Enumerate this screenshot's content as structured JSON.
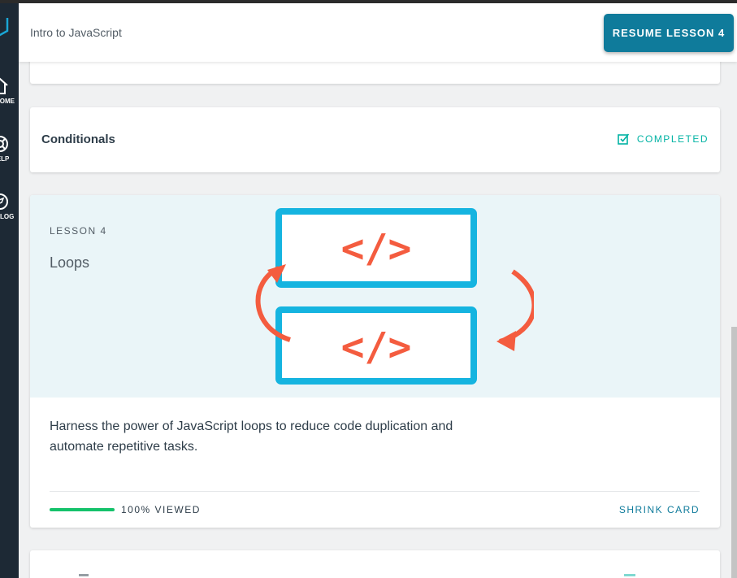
{
  "header": {
    "title": "Intro to JavaScript",
    "resume_label": "RESUME LESSON 4"
  },
  "sidebar": {
    "items": [
      {
        "icon": "home-icon",
        "label": "HOME"
      },
      {
        "icon": "help-icon",
        "label": "HELP"
      },
      {
        "icon": "catalog-icon",
        "label": "CATALOG"
      }
    ]
  },
  "cards": {
    "conditionals": {
      "title": "Conditionals",
      "status": "COMPLETED"
    },
    "loops": {
      "lesson_number": "LESSON 4",
      "title": "Loops",
      "description": "Harness the power of JavaScript loops to reduce code duplication and automate repetitive tasks.",
      "progress_label": "100% VIEWED",
      "progress_fraction": 1.0,
      "shrink_label": "SHRINK CARD",
      "illustration_code_glyph": "</>"
    }
  },
  "colors": {
    "accent": "#0f7b9b",
    "completed": "#02b3a4",
    "progress": "#15c26b",
    "sidebar": "#1d2935",
    "illustration_frame": "#15b4e0",
    "illustration_code": "#f45c3f"
  }
}
